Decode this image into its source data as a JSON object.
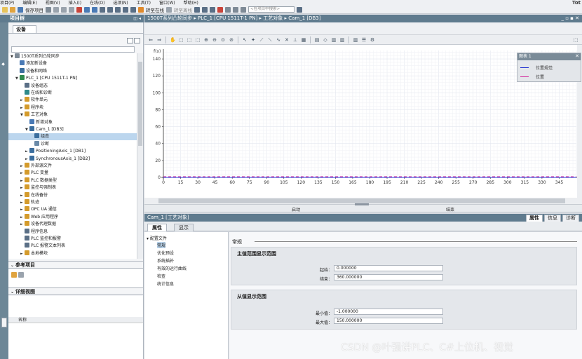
{
  "menu": [
    "项目(P)",
    "编辑(E)",
    "视图(V)",
    "插入(I)",
    "在线(O)",
    "选项(N)",
    "工具(T)",
    "窗口(W)",
    "帮助(H)"
  ],
  "tia_label": "Tot",
  "toolbar": {
    "save_project": "保存项目",
    "go_online": "转至在线",
    "go_offline": "转至离线",
    "search_placeholder": "<在项目中搜索>"
  },
  "project_tree": {
    "title": "项目树",
    "devices_tab": "设备",
    "items": [
      {
        "label": "1500T系列凸轮同步",
        "level": 0,
        "arrow": "▼",
        "icon": "project-icon",
        "color": "#7e8a96"
      },
      {
        "label": "添加新设备",
        "level": 1,
        "arrow": "",
        "icon": "add-device-icon",
        "color": "#4a7ab5"
      },
      {
        "label": "设备和网络",
        "level": 1,
        "arrow": "",
        "icon": "network-icon",
        "color": "#3b6e9e"
      },
      {
        "label": "PLC_1 [CPU 1511T-1 PN]",
        "level": 1,
        "arrow": "▼",
        "icon": "plc-icon",
        "color": "#2f8a4e"
      },
      {
        "label": "设备组态",
        "level": 2,
        "arrow": "",
        "icon": "device-config-icon",
        "color": "#5a6f86"
      },
      {
        "label": "在线和诊断",
        "level": 2,
        "arrow": "",
        "icon": "online-diag-icon",
        "color": "#2f8a8a"
      },
      {
        "label": "软件单元",
        "level": 2,
        "arrow": "►",
        "icon": "software-units-icon",
        "color": "#d49b2c"
      },
      {
        "label": "程序块",
        "level": 2,
        "arrow": "►",
        "icon": "program-blocks-icon",
        "color": "#d49b2c"
      },
      {
        "label": "工艺对象",
        "level": 2,
        "arrow": "▼",
        "icon": "technology-objects-icon",
        "color": "#d49b2c"
      },
      {
        "label": "新增对象",
        "level": 3,
        "arrow": "",
        "icon": "add-object-icon",
        "color": "#4a7ab5"
      },
      {
        "label": "Cam_1 [DB3]",
        "level": 3,
        "arrow": "▼",
        "icon": "cam-icon",
        "color": "#3b6e9e"
      },
      {
        "label": "组态",
        "level": 4,
        "arrow": "",
        "icon": "configuration-icon",
        "color": "#3b6e9e",
        "selected": true
      },
      {
        "label": "诊断",
        "level": 4,
        "arrow": "",
        "icon": "diagnostics-icon",
        "color": "#6a8aa8"
      },
      {
        "label": "PositioningAxis_1 [DB1]",
        "level": 3,
        "arrow": "►",
        "icon": "positioning-axis-icon",
        "color": "#3b6e9e"
      },
      {
        "label": "SynchronousAxis_1 [DB2]",
        "level": 3,
        "arrow": "►",
        "icon": "synchronous-axis-icon",
        "color": "#3b6e9e"
      },
      {
        "label": "外部源文件",
        "level": 2,
        "arrow": "►",
        "icon": "external-files-icon",
        "color": "#d49b2c"
      },
      {
        "label": "PLC 变量",
        "level": 2,
        "arrow": "►",
        "icon": "plc-tags-icon",
        "color": "#d49b2c"
      },
      {
        "label": "PLC 数据类型",
        "level": 2,
        "arrow": "►",
        "icon": "plc-data-types-icon",
        "color": "#d49b2c"
      },
      {
        "label": "监控与强制表",
        "level": 2,
        "arrow": "►",
        "icon": "watch-tables-icon",
        "color": "#d49b2c"
      },
      {
        "label": "在线备份",
        "level": 2,
        "arrow": "►",
        "icon": "online-backup-icon",
        "color": "#d49b2c"
      },
      {
        "label": "轨迹",
        "level": 2,
        "arrow": "►",
        "icon": "traces-icon",
        "color": "#d49b2c"
      },
      {
        "label": "OPC UA 通信",
        "level": 2,
        "arrow": "►",
        "icon": "opcua-icon",
        "color": "#d49b2c"
      },
      {
        "label": "Web 应用程序",
        "level": 2,
        "arrow": "►",
        "icon": "web-app-icon",
        "color": "#d49b2c"
      },
      {
        "label": "设备代理数据",
        "level": 2,
        "arrow": "►",
        "icon": "device-proxy-icon",
        "color": "#d49b2c"
      },
      {
        "label": "程序信息",
        "level": 2,
        "arrow": "",
        "icon": "program-info-icon",
        "color": "#5a6f86"
      },
      {
        "label": "PLC 监控和报警",
        "level": 2,
        "arrow": "",
        "icon": "plc-alarms-icon",
        "color": "#5a6f86"
      },
      {
        "label": "PLC 报警文本列表",
        "level": 2,
        "arrow": "",
        "icon": "alarm-text-icon",
        "color": "#5a6f86"
      },
      {
        "label": "本地模块",
        "level": 2,
        "arrow": "►",
        "icon": "local-modules-icon",
        "color": "#d49b2c"
      }
    ]
  },
  "reference_projects": {
    "title": "参考项目"
  },
  "details_view": {
    "title": "详细视图",
    "column_name": "名称"
  },
  "breadcrumb": {
    "text": "1500T系列凸轮同步 ▸ PLC_1 [CPU 1511T-1 PN] ▸ 工艺对象 ▸ Cam_1 [DB3]"
  },
  "chart_data": {
    "type": "line",
    "ylabel": "f(x)",
    "xlim": [
      0,
      360
    ],
    "ylim": [
      0,
      150
    ],
    "x_ticks": [
      0,
      15,
      30,
      45,
      60,
      75,
      90,
      105,
      120,
      135,
      150,
      165,
      180,
      195,
      210,
      225,
      240,
      255,
      270,
      285,
      300,
      315,
      330,
      345
    ],
    "y_ticks": [
      0,
      20,
      40,
      60,
      80,
      100,
      120,
      140
    ],
    "grid": true,
    "series": [
      {
        "name": "位置规范",
        "color": "#1f2fd0",
        "style": "solid",
        "x": [
          0,
          360
        ],
        "y": [
          0,
          0
        ]
      },
      {
        "name": "位置",
        "color": "#d2239a",
        "style": "dashed",
        "x": [
          0,
          360
        ],
        "y": [
          0,
          0
        ]
      }
    ],
    "legend": {
      "title": "图表 1",
      "placement": "top-right"
    }
  },
  "split": {
    "start": "启动",
    "end": "结束"
  },
  "inspector": {
    "header": "Cam_1 [工艺对象]",
    "right_tabs": [
      "属性",
      "信息",
      "诊断"
    ],
    "tabs": [
      "属性",
      "显示"
    ],
    "nav": {
      "root": "配置文件",
      "items": [
        "常规",
        "优化预设",
        "系统插补",
        "有效的运行曲线",
        "检查",
        "统计信息"
      ]
    },
    "general_title": "常规",
    "master_group": {
      "title": "主值范围显示范围",
      "start_label": "起始：",
      "start_value": "0.000000",
      "end_label": "结束：",
      "end_value": "360.000000"
    },
    "slave_group": {
      "title": "从值显示范围",
      "min_label": "最小值：",
      "min_value": "-1.000000",
      "max_label": "最大值：",
      "max_value": "150.000000"
    }
  },
  "watermark": "CSDN @叶强讲PLC、C#上位机、视觉"
}
